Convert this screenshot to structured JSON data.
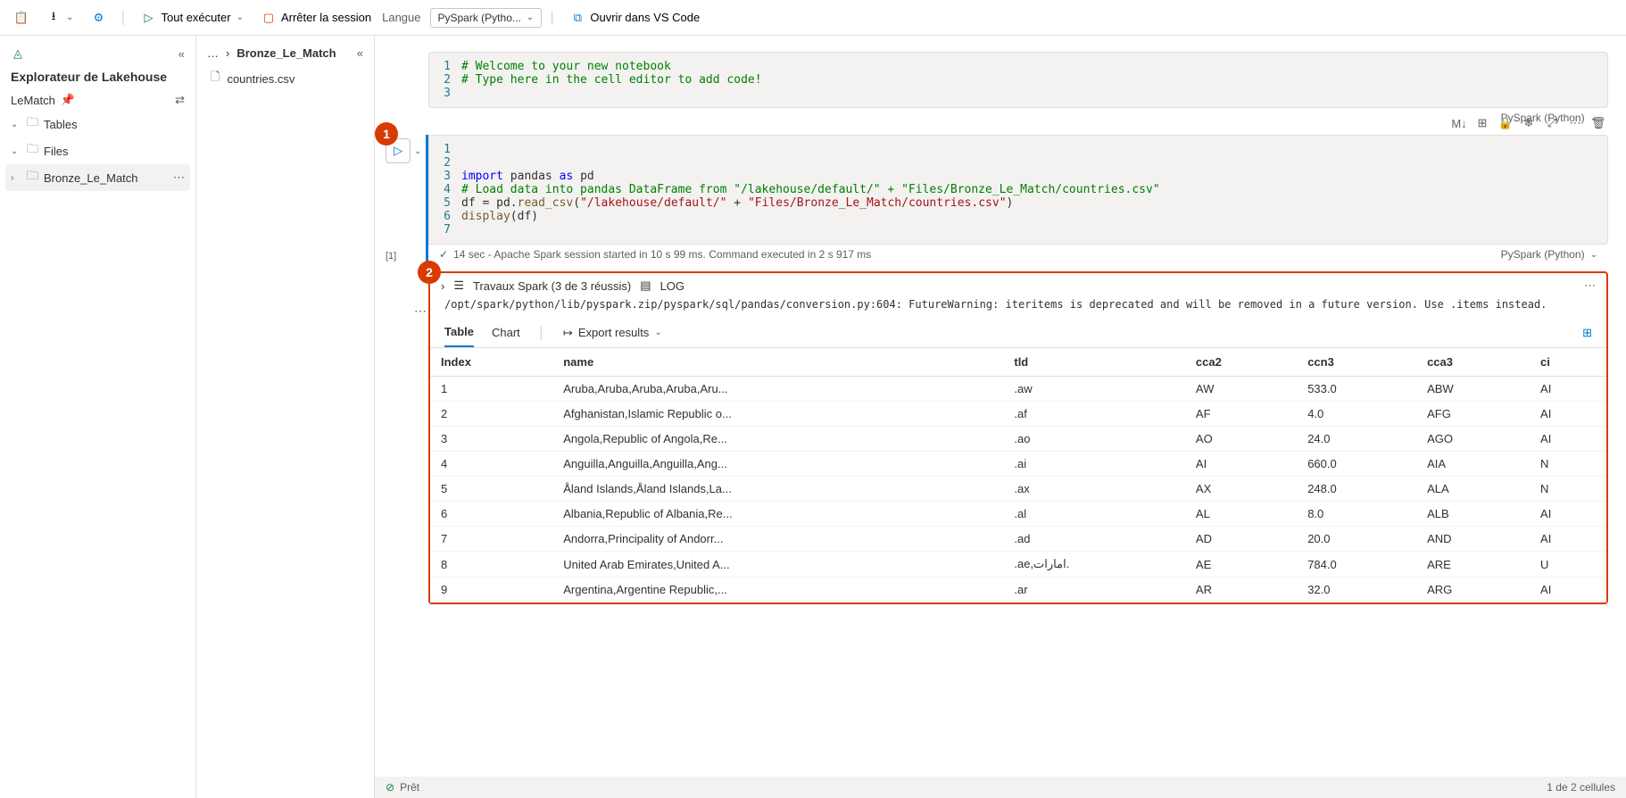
{
  "toolbar": {
    "run_all": "Tout exécuter",
    "stop_session": "Arrêter la session",
    "language_label": "Langue",
    "language_value": "PySpark (Pytho...",
    "open_vscode": "Ouvrir dans VS Code"
  },
  "sidebar": {
    "title": "Explorateur de Lakehouse",
    "lakehouse_name": "LeMatch",
    "tables": "Tables",
    "files": "Files",
    "selected_folder": "Bronze_Le_Match"
  },
  "breadcrumb": {
    "dots": "…",
    "item": "Bronze_Le_Match"
  },
  "files": {
    "item1": "countries.csv"
  },
  "cell1": {
    "n1": "1",
    "n2": "2",
    "n3": "3",
    "l1": "# Welcome to your new notebook",
    "l2": "# Type here in the cell editor to add code!",
    "l3": "",
    "footer": "PySpark (Python)"
  },
  "cell2": {
    "n1": "1",
    "n2": "2",
    "n3": "3",
    "n4": "4",
    "n5": "5",
    "n6": "6",
    "n7": "7",
    "exec_count": "[1]",
    "status": "14 sec - Apache Spark session started in 10 s 99 ms. Command executed in 2 s 917 ms",
    "footer": "PySpark (Python)"
  },
  "output": {
    "jobs_label": "Travaux Spark (3 de 3 réussis)",
    "log_label": "LOG",
    "warning": "/opt/spark/python/lib/pyspark.zip/pyspark/sql/pandas/conversion.py:604: FutureWarning: iteritems is deprecated and will be removed in a future version. Use .items instead.",
    "tab_table": "Table",
    "tab_chart": "Chart",
    "export": "Export results"
  },
  "table": {
    "headers": [
      "Index",
      "name",
      "tld",
      "cca2",
      "ccn3",
      "cca3",
      "ci"
    ],
    "rows": [
      [
        "1",
        "Aruba,Aruba,Aruba,Aruba,Aru...",
        ".aw",
        "AW",
        "533.0",
        "ABW",
        "AI"
      ],
      [
        "2",
        "Afghanistan,Islamic Republic o...",
        ".af",
        "AF",
        "4.0",
        "AFG",
        "AI"
      ],
      [
        "3",
        "Angola,Republic of Angola,Re...",
        ".ao",
        "AO",
        "24.0",
        "AGO",
        "AI"
      ],
      [
        "4",
        "Anguilla,Anguilla,Anguilla,Ang...",
        ".ai",
        "AI",
        "660.0",
        "AIA",
        "N"
      ],
      [
        "5",
        "Åland Islands,Åland Islands,La...",
        ".ax",
        "AX",
        "248.0",
        "ALA",
        "N"
      ],
      [
        "6",
        "Albania,Republic of Albania,Re...",
        ".al",
        "AL",
        "8.0",
        "ALB",
        "AI"
      ],
      [
        "7",
        "Andorra,Principality of Andorr...",
        ".ad",
        "AD",
        "20.0",
        "AND",
        "AI"
      ],
      [
        "8",
        "United Arab Emirates,United A...",
        ".ae,امارات.",
        "AE",
        "784.0",
        "ARE",
        "U"
      ],
      [
        "9",
        "Argentina,Argentine Republic,...",
        ".ar",
        "AR",
        "32.0",
        "ARG",
        "AI"
      ]
    ]
  },
  "statusbar": {
    "ready": "Prêt",
    "cells": "1 de 2 cellules"
  },
  "annotations": {
    "a1": "1",
    "a2": "2"
  }
}
